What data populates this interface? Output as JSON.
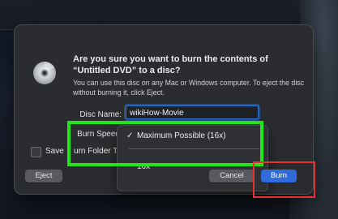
{
  "dialog": {
    "title": "Are you sure you want to burn the contents of “Untitled DVD” to a disc?",
    "message": "You can use this disc on any Mac or Windows computer. To eject the disc without burning it, click Eject.",
    "disc_name_label": "Disc Name:",
    "disc_name_value": "wikiHow-Movie",
    "burn_speed_label": "Burn Speed",
    "save_label_visible": "Save",
    "save_label_partial": "urn Folder To",
    "eject_button": "Eject",
    "cancel_button": "Cancel",
    "burn_button": "Burn",
    "icon": "dvd-disc-icon"
  },
  "burn_speed_menu": {
    "check": "✓",
    "options": [
      "Maximum Possible (16x)",
      "16x"
    ],
    "selected_index": 0
  },
  "annotations": {
    "green_highlight_color": "#23e31b",
    "red_highlight_color": "#e53232"
  },
  "colors": {
    "accent": "#2f6cd9",
    "dialog_bg": "#2b2c2f"
  }
}
